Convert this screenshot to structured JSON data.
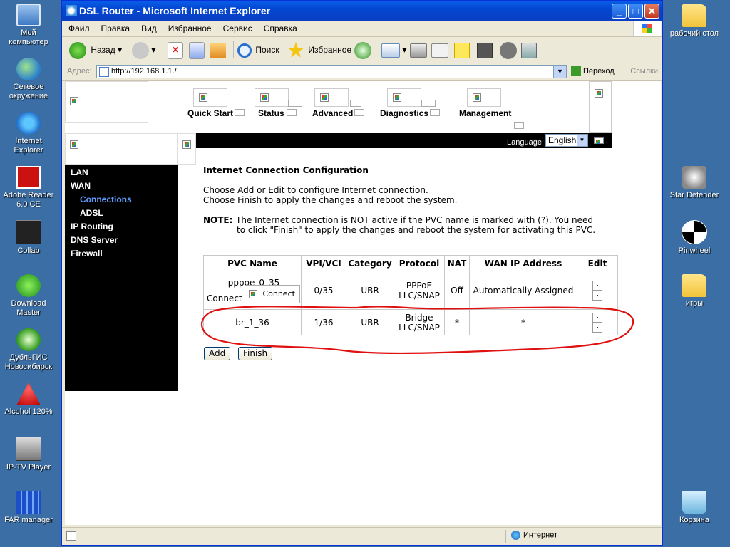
{
  "desktop": {
    "left_icons": [
      {
        "label": "Мой компьютер"
      },
      {
        "label": "Сетевое окружение"
      },
      {
        "label": "Internet Explorer"
      },
      {
        "label": "Adobe Reader 6.0 CE"
      },
      {
        "label": "Collab"
      },
      {
        "label": "Download Master"
      },
      {
        "label": "ДубльГИС Новосибирск"
      },
      {
        "label": "Alcohol 120%"
      },
      {
        "label": "IP-TV Player"
      },
      {
        "label": "FAR manager"
      }
    ],
    "right_icons": [
      {
        "label": "рабочий стол"
      },
      {
        "label": "Star Defender"
      },
      {
        "label": "Pinwheel"
      },
      {
        "label": "игры"
      },
      {
        "label": "Корзина"
      }
    ]
  },
  "window": {
    "title": "DSL Router - Microsoft Internet Explorer",
    "menu": [
      "Файл",
      "Правка",
      "Вид",
      "Избранное",
      "Сервис",
      "Справка"
    ],
    "toolbar": {
      "back": "Назад",
      "search": "Поиск",
      "favorites": "Избранное"
    },
    "address": {
      "label": "Адрес:",
      "url": "http://192.168.1.1./",
      "go": "Переход",
      "links": "Ссылки"
    },
    "status": {
      "zone": "Интернет"
    }
  },
  "router": {
    "nav": [
      "Quick Start",
      "Status",
      "Advanced",
      "Diagnostics",
      "Management"
    ],
    "language_label": "Language:",
    "language_value": "English",
    "sidebar": [
      {
        "label": "LAN"
      },
      {
        "label": "WAN"
      },
      {
        "label": "Connections"
      },
      {
        "label": "ADSL"
      },
      {
        "label": "IP Routing"
      },
      {
        "label": "DNS Server"
      },
      {
        "label": "Firewall"
      }
    ],
    "heading": "Internet Connection Configuration",
    "intro_line1": "Choose Add or Edit to configure Internet connection.",
    "intro_line2": "Choose Finish to apply the changes and reboot the system.",
    "note_label": "NOTE:",
    "note_line1": "The Internet connection is NOT active if the PVC name is marked with (?). You need",
    "note_line2": "to click \"Finish\" to apply the changes and reboot the system for activating this PVC.",
    "table": {
      "headers": [
        "PVC Name",
        "VPI/VCI",
        "Category",
        "Protocol",
        "NAT",
        "WAN IP Address",
        "Edit"
      ],
      "rows": [
        {
          "pvc": "pppoe_0_35",
          "connect_label": "Connect",
          "connect_button": "Connect",
          "vpivci": "0/35",
          "category": "UBR",
          "protocol_1": "PPPoE",
          "protocol_2": "LLC/SNAP",
          "nat": "Off",
          "wan_ip": "Automatically Assigned"
        },
        {
          "pvc": "br_1_36",
          "vpivci": "1/36",
          "category": "UBR",
          "protocol_1": "Bridge",
          "protocol_2": "LLC/SNAP",
          "nat": "*",
          "wan_ip": "*"
        }
      ]
    },
    "buttons": {
      "add": "Add",
      "finish": "Finish"
    },
    "highlight_color": "#e01010"
  }
}
